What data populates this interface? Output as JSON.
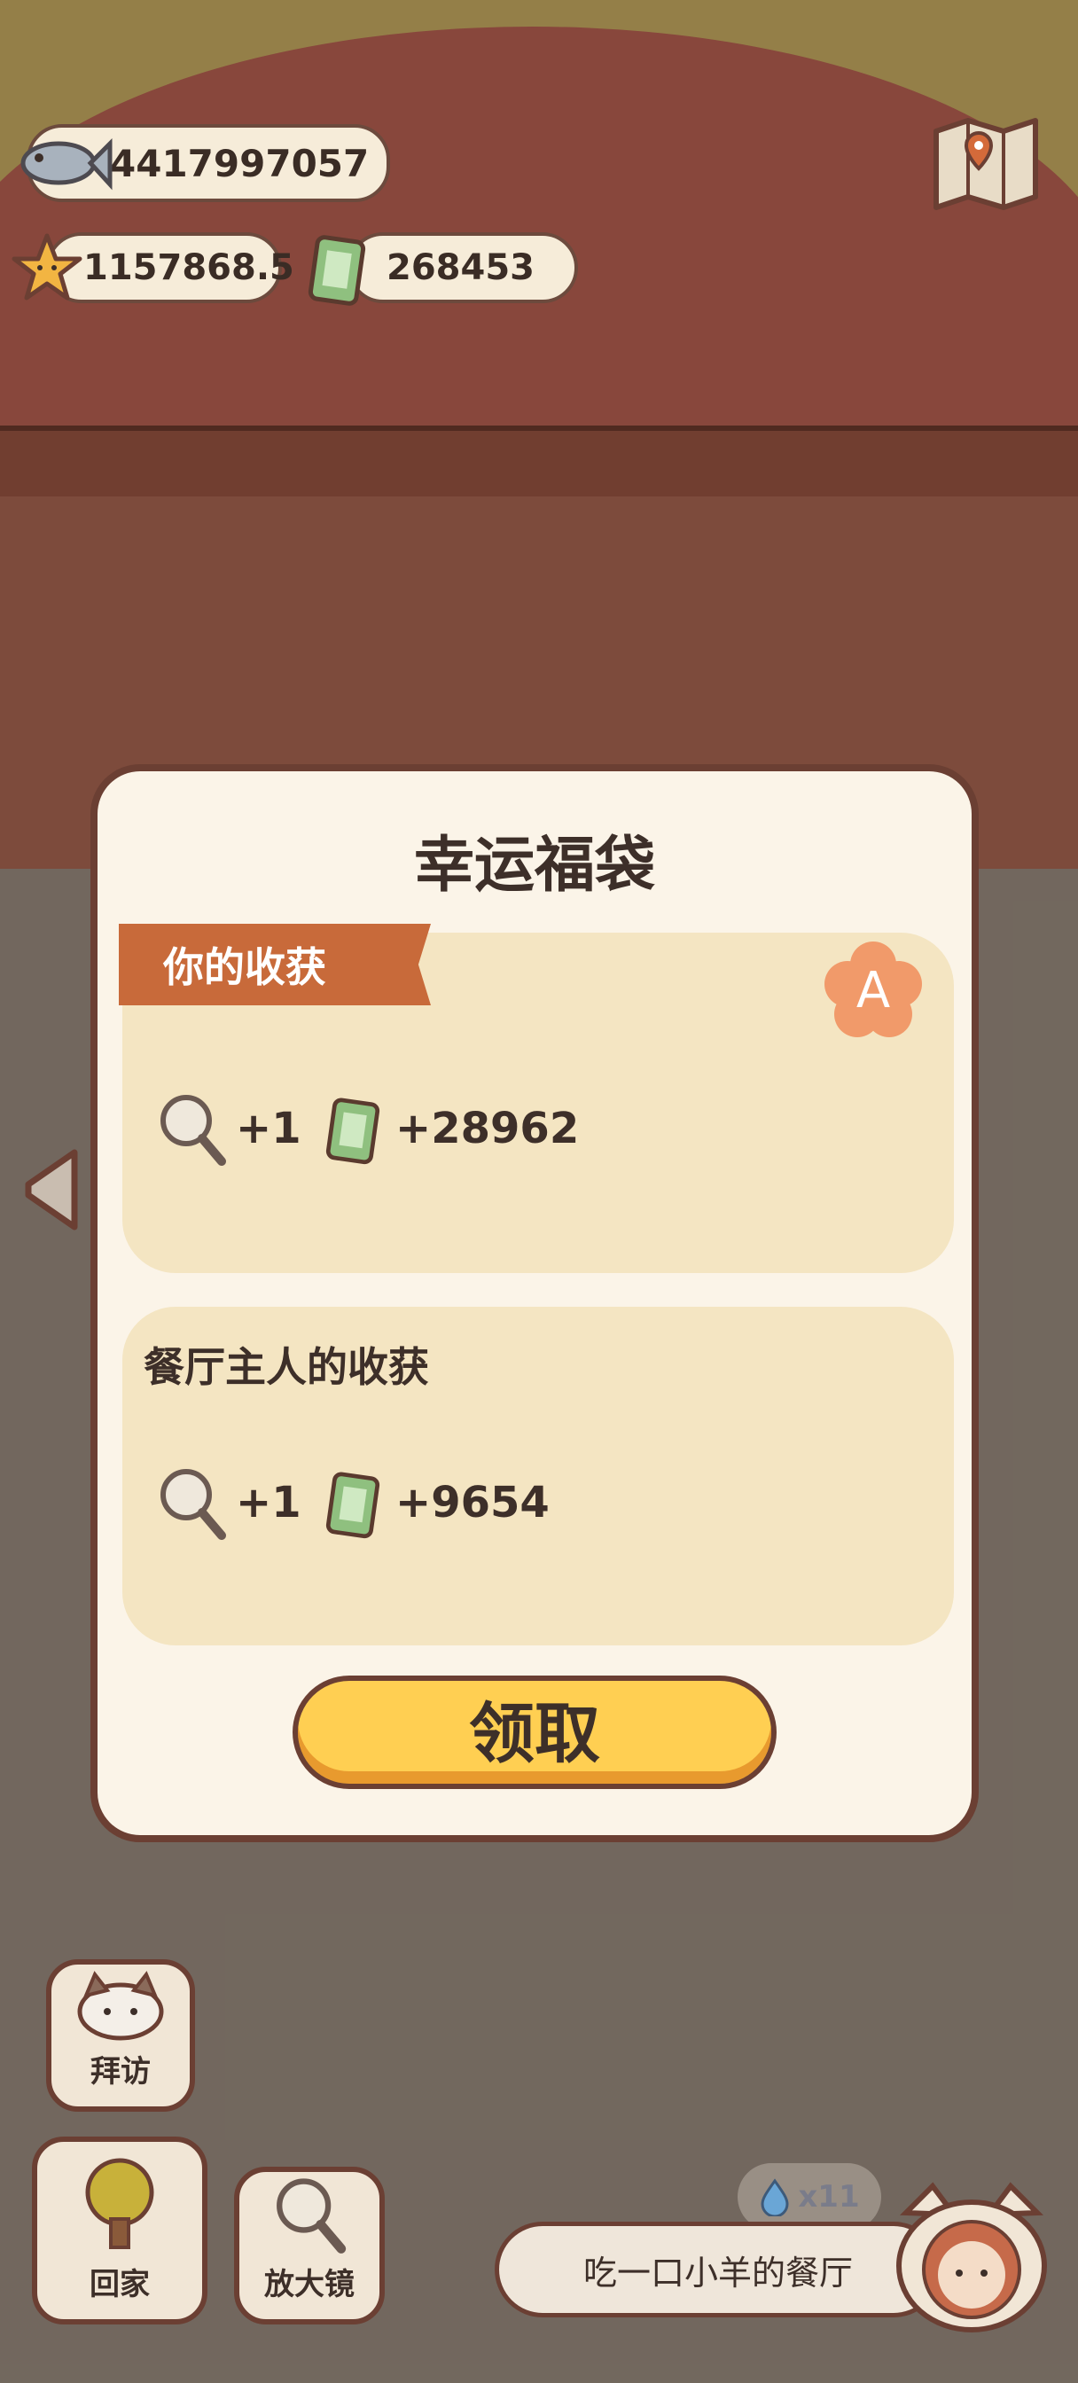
{
  "resources": {
    "fish": {
      "icon": "fish-icon",
      "value": "4417997057"
    },
    "star": {
      "icon": "star-icon",
      "value": "1157868.5"
    },
    "cash": {
      "icon": "can-icon",
      "value": "268453"
    }
  },
  "modal": {
    "title": "幸运福袋",
    "yours": {
      "label": "你的收获",
      "grade": "A",
      "rewards": [
        {
          "icon": "magnifier-icon",
          "value": "+1"
        },
        {
          "icon": "can-icon",
          "value": "+28962"
        }
      ]
    },
    "owner": {
      "label": "餐厅主人的收获",
      "rewards": [
        {
          "icon": "magnifier-icon",
          "value": "+1"
        },
        {
          "icon": "can-icon",
          "value": "+9654"
        }
      ]
    },
    "claim_label": "领取"
  },
  "nav": {
    "visit": "拜访",
    "home": "回家",
    "magnifier": "放大镜"
  },
  "restaurant_name": "吃一口小羊的餐厅",
  "water_count": "x11",
  "colors": {
    "accent": "#ffcf52",
    "banner": "#c86a3a",
    "border": "#6b3f33",
    "card": "#f4e5c2"
  }
}
